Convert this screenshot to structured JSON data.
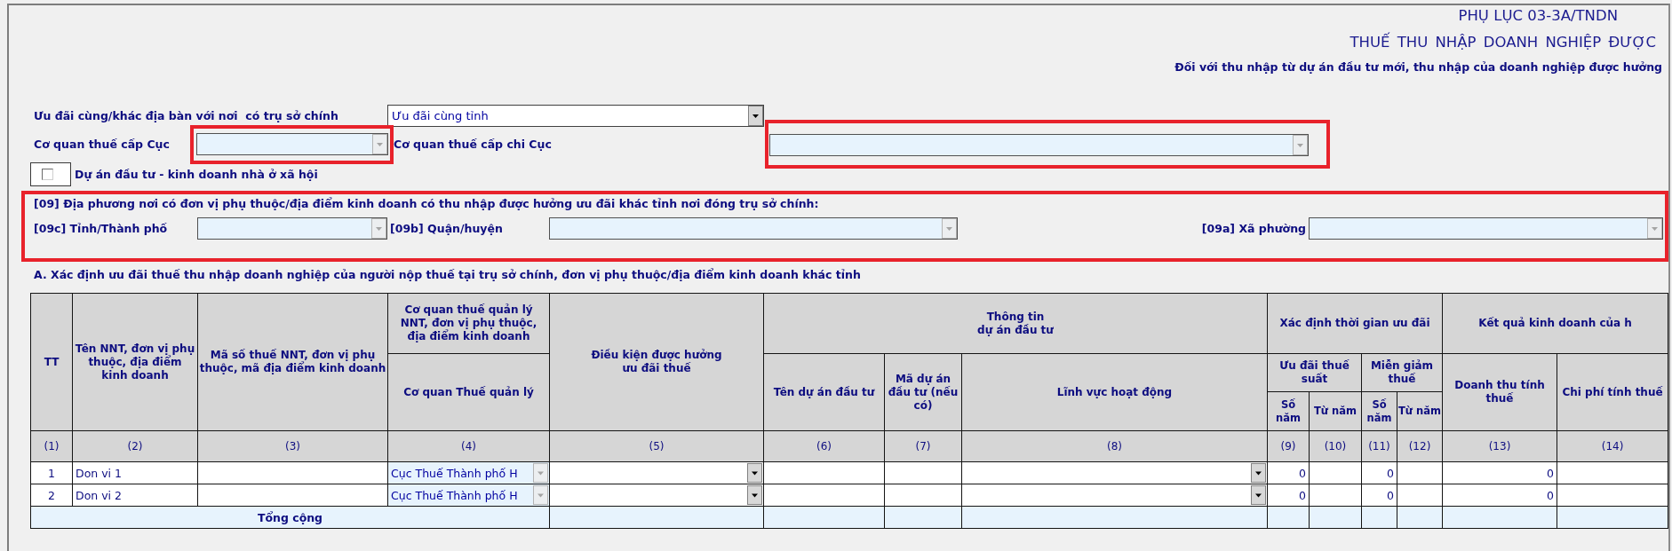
{
  "header": {
    "code": "PHỤ LỤC 03-3A/TNDN",
    "title": "THUẾ THU NHẬP DOANH NGHIỆP ĐƯỢC",
    "subtitle": "Đối với thu nhập từ dự án đầu tư mới, thu nhập của doanh nghiệp được hưởng"
  },
  "form": {
    "preference_area": {
      "label": "Ưu đãi cùng/khác địa bàn với nơi  có trụ sở chính",
      "value": "Ưu đãi cùng tỉnh",
      "disabled": false
    },
    "department": {
      "label": "Cơ quan thuế cấp Cục",
      "disabled": true,
      "highlighted": true
    },
    "sub_department": {
      "label": "Cơ quan thuế cấp chi Cục",
      "disabled": true,
      "highlighted": true
    },
    "social_housing": {
      "label": "Dự án đầu tư - kinh doanh nhà ở xã hội",
      "checked": false
    }
  },
  "section_09": {
    "highlighted": true,
    "title": "[09] Địa phương nơi có đơn vị phụ thuộc/địa điểm kinh doanh có thu nhập được hưởng ưu đãi khác tỉnh nơi đóng trụ sở chính:",
    "fields": [
      {
        "label": "[09c] Tỉnh/Thành phố",
        "disabled": true
      },
      {
        "label": "[09b] Quận/huyện",
        "disabled": true
      },
      {
        "label": "[09a] Xã phường",
        "disabled": true
      }
    ]
  },
  "section_a": {
    "title": "A. Xác định ưu đãi thuế thu nhập doanh nghiệp của người nộp thuế tại trụ sở chính, đơn vị phụ thuộc/địa điểm kinh doanh khác tỉnh",
    "table": {
      "header_rows": [
        [
          {
            "label": "TT",
            "rowspan": 3
          },
          {
            "label": "Tên NNT, đơn vị phụ thuộc, địa điểm kinh doanh",
            "rowspan": 3
          },
          {
            "label": "Mã số thuế NNT, đơn vị phụ thuộc, mã địa điểm kinh doanh",
            "rowspan": 3
          },
          {
            "label": "Cơ quan thuế quản lý\nNNT, đơn vị phụ thuộc,\nđịa điểm kinh doanh"
          },
          {
            "label": "Điều kiện được hưởng\nưu đãi thuế",
            "rowspan": 3
          },
          {
            "label": "Thông tin\ndự án đầu tư",
            "colspan": 3
          },
          {
            "label": "Xác định thời gian ưu đãi",
            "colspan": 4
          },
          {
            "label": "Kết quả kinh doanh của h",
            "colspan": 2
          }
        ],
        [
          {
            "label": "Cơ quan Thuế quản lý",
            "rowspan": 2
          },
          {
            "label": "Tên dự án đầu tư",
            "rowspan": 2
          },
          {
            "label": "Mã dự án đầu tư (nếu có)",
            "rowspan": 2
          },
          {
            "label": "Lĩnh vực hoạt động",
            "rowspan": 2
          },
          {
            "label": "Ưu đãi thuế suất",
            "colspan": 2
          },
          {
            "label": "Miễn giảm thuế",
            "colspan": 2
          },
          {
            "label": "Doanh thu tính thuế",
            "rowspan": 2
          },
          {
            "label": "Chi phí tính thuế",
            "rowspan": 2
          }
        ],
        [
          {
            "label": "Số năm"
          },
          {
            "label": "Từ năm"
          },
          {
            "label": "Số năm"
          },
          {
            "label": "Từ năm"
          }
        ]
      ],
      "column_numbers": [
        "(1)",
        "(2)",
        "(3)",
        "(4)",
        "(5)",
        "(6)",
        "(7)",
        "(8)",
        "(9)",
        "(10)",
        "(11)",
        "(12)",
        "(13)",
        "(14)"
      ],
      "rows": [
        {
          "cells": [
            {
              "kind": "index",
              "text": "1"
            },
            {
              "kind": "text",
              "text": "Don vi 1"
            },
            {
              "kind": "blank"
            },
            {
              "kind": "select",
              "value": "Cục Thuế Thành phố H",
              "disabled": true
            },
            {
              "kind": "select",
              "disabled": false
            },
            {
              "kind": "blank"
            },
            {
              "kind": "blank"
            },
            {
              "kind": "select",
              "disabled": false
            },
            {
              "kind": "number",
              "text": "0"
            },
            {
              "kind": "blank"
            },
            {
              "kind": "number",
              "text": "0"
            },
            {
              "kind": "blank"
            },
            {
              "kind": "number",
              "text": "0"
            },
            {
              "kind": "blank"
            }
          ]
        },
        {
          "cells": [
            {
              "kind": "index",
              "text": "2"
            },
            {
              "kind": "text",
              "text": "Don vi 2"
            },
            {
              "kind": "blank"
            },
            {
              "kind": "select",
              "value": "Cục Thuế Thành phố H",
              "disabled": true
            },
            {
              "kind": "select",
              "disabled": false
            },
            {
              "kind": "blank"
            },
            {
              "kind": "blank"
            },
            {
              "kind": "select",
              "disabled": false
            },
            {
              "kind": "number",
              "text": "0"
            },
            {
              "kind": "blank"
            },
            {
              "kind": "number",
              "text": "0"
            },
            {
              "kind": "blank"
            },
            {
              "kind": "number",
              "text": "0"
            },
            {
              "kind": "blank"
            }
          ]
        }
      ],
      "total": {
        "label": "Tổng cộng"
      }
    }
  }
}
